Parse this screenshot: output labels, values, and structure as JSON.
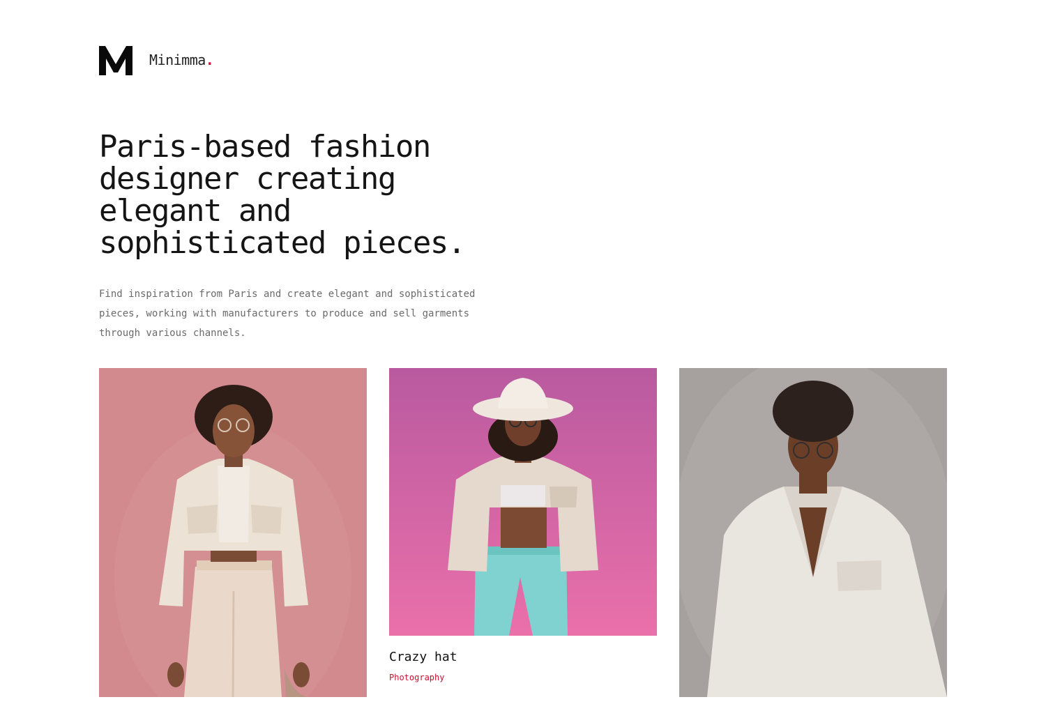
{
  "brand": {
    "name": "Minimma",
    "dot": ".",
    "logo_icon": "m-logo-icon"
  },
  "hero": {
    "title": "Paris-based fashion designer creating elegant and sophisticated pieces.",
    "description": "Find inspiration from Paris and create elegant and sophisticated pieces, working with manufacturers to produce and sell garments through various channels."
  },
  "colors": {
    "accent": "#e6003a",
    "category": "#c8102e",
    "text": "#151515",
    "muted": "#6a6a6a"
  },
  "portfolio": [
    {
      "image": "woman-in-cream-jacket-pink-background",
      "title": "",
      "category": ""
    },
    {
      "image": "woman-in-white-hat-and-teal-pants-magenta-background",
      "title": "Crazy hat",
      "category": "Photography"
    },
    {
      "image": "man-in-cream-jacket-grey-background",
      "title": "",
      "category": ""
    }
  ]
}
